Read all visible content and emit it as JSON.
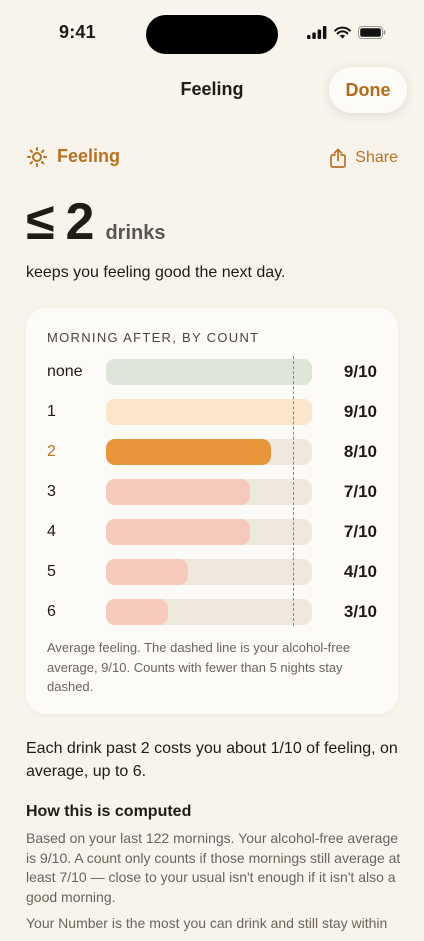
{
  "status": {
    "time": "9:41"
  },
  "nav": {
    "title": "Feeling",
    "done": "Done"
  },
  "section": {
    "label": "Feeling",
    "icon": "sun-icon",
    "share": "Share",
    "share_icon": "share-icon"
  },
  "headline": {
    "symbol": "≤",
    "number": "2",
    "unit": "drinks",
    "subtitle": "keeps you feeling good the next day."
  },
  "chart_data": {
    "type": "bar",
    "title": "MORNING AFTER, BY COUNT",
    "categories": [
      "none",
      "1",
      "2",
      "3",
      "4",
      "5",
      "6"
    ],
    "values": [
      9,
      9,
      8,
      7,
      7,
      4,
      3
    ],
    "value_labels": [
      "9/10",
      "9/10",
      "8/10",
      "7/10",
      "7/10",
      "4/10",
      "3/10"
    ],
    "xlim": [
      0,
      10
    ],
    "reference_line": 9,
    "highlight": "2",
    "colors": [
      "#dfe5d8",
      "#fbe6cc",
      "#e8963a",
      "#f6cbbd",
      "#f6cbbd",
      "#f6cbbd",
      "#f6cbbd"
    ],
    "reference_color": "#c0782f",
    "caption": "Average feeling. The dashed line is your alcohol-free average, 9/10. Counts with fewer than 5 nights stay dashed."
  },
  "summary": "Each drink past 2 costs you about 1/10 of feeling, on average, up to 6.",
  "how": {
    "title": "How this is computed",
    "p1": "Based on your last 122 mornings. Your alcohol-free average is 9/10. A count only counts if those mornings still average at least 7/10 — close to your usual isn't enough if it isn't also a good morning.",
    "p2": "Your Number is the most you can drink and still stay within"
  }
}
